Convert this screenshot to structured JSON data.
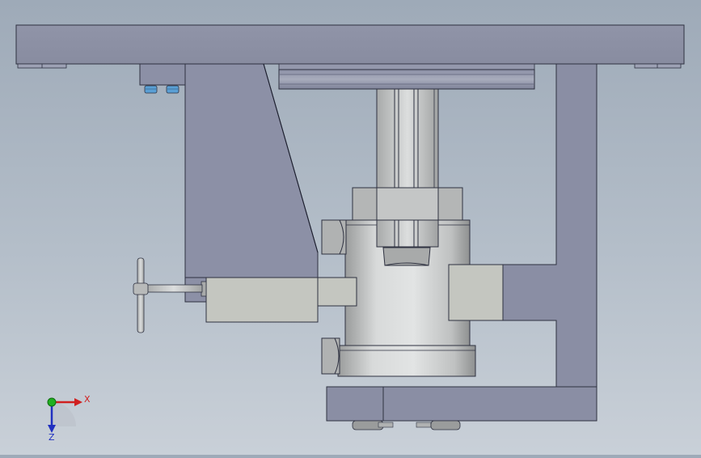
{
  "view": {
    "kind": "cad-front-view",
    "background_top": "#9eaab8",
    "background_bottom": "#c9d0d8"
  },
  "colors": {
    "frame_blue_gray": "#8a8fa8",
    "frame_edge": "#3a3d4a",
    "cylinder_gray": "#c6c8c8",
    "block_gray": "#c2c4bf",
    "fastener_blue": "#5a9fd4",
    "axis_x": "#d02020",
    "axis_y": "#20b020",
    "axis_z": "#2030c0"
  },
  "triad": {
    "x_label": "X",
    "z_label": "Z"
  }
}
